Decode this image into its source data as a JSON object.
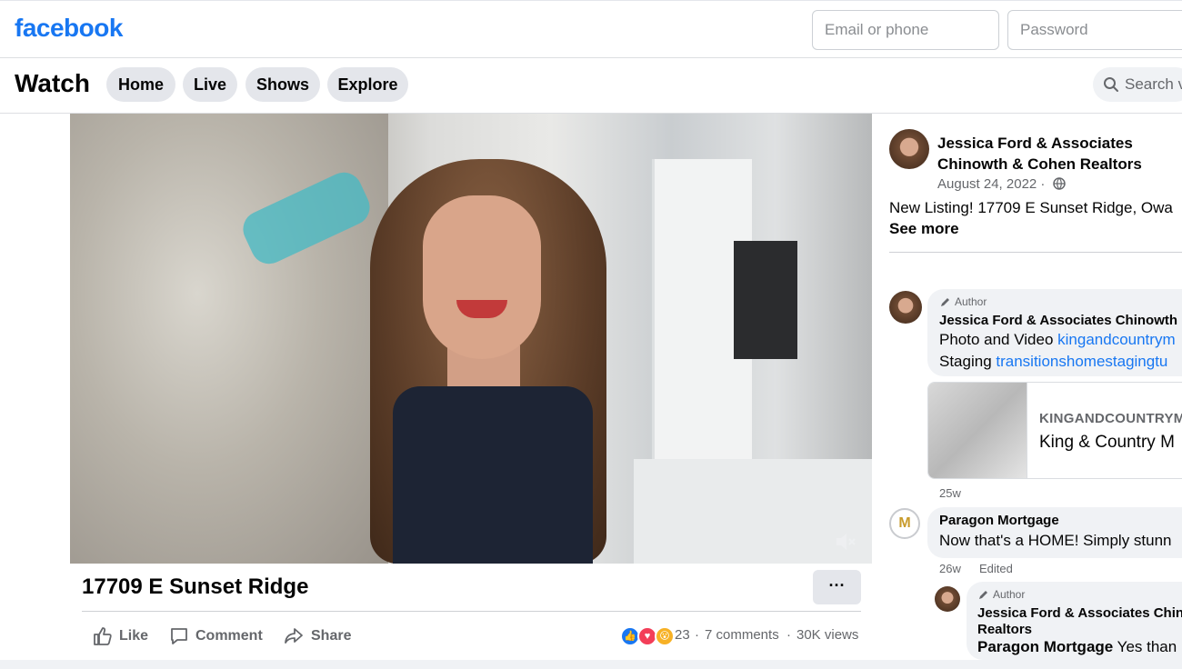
{
  "header": {
    "logo": "facebook",
    "email_placeholder": "Email or phone",
    "password_placeholder": "Password"
  },
  "watch": {
    "title": "Watch",
    "tabs": [
      "Home",
      "Live",
      "Shows",
      "Explore"
    ],
    "search_placeholder": "Search v"
  },
  "video": {
    "title": "17709 E Sunset Ridge",
    "more_label": "···",
    "actions": {
      "like": "Like",
      "comment": "Comment",
      "share": "Share"
    },
    "reaction_count": "23",
    "comments": "7 comments",
    "views": "30K views",
    "dot": "·"
  },
  "post": {
    "page_name": "Jessica Ford & Associates Chinowth & Cohen Realtors",
    "date": "August 24, 2022 ·",
    "text": "New Listing! 17709 E Sunset Ridge, Owa",
    "see_more": "See more"
  },
  "comments": [
    {
      "author_tag": "Author",
      "name": "Jessica Ford & Associates Chinowth",
      "line1_prefix": "Photo and Video ",
      "line1_link": "kingandcountrym",
      "line2_prefix": "Staging ",
      "line2_link": "transitionshomestagingtu",
      "link_card": {
        "domain": "KINGANDCOUNTRYM",
        "title": "King & Country M"
      },
      "time": "25w"
    },
    {
      "name": "Paragon Mortgage",
      "text": "Now that's a HOME! Simply stunn",
      "time": "26w",
      "edited": "Edited",
      "logo_letter": "M"
    },
    {
      "author_tag": "Author",
      "name_line1": "Jessica Ford & Associates Chin",
      "name_line2": "Realtors",
      "mention": "Paragon Mortgage",
      "text": " Yes than"
    }
  ],
  "colors": {
    "brand": "#1877f2",
    "link": "#1877f2",
    "secondary_text": "#65676b"
  }
}
